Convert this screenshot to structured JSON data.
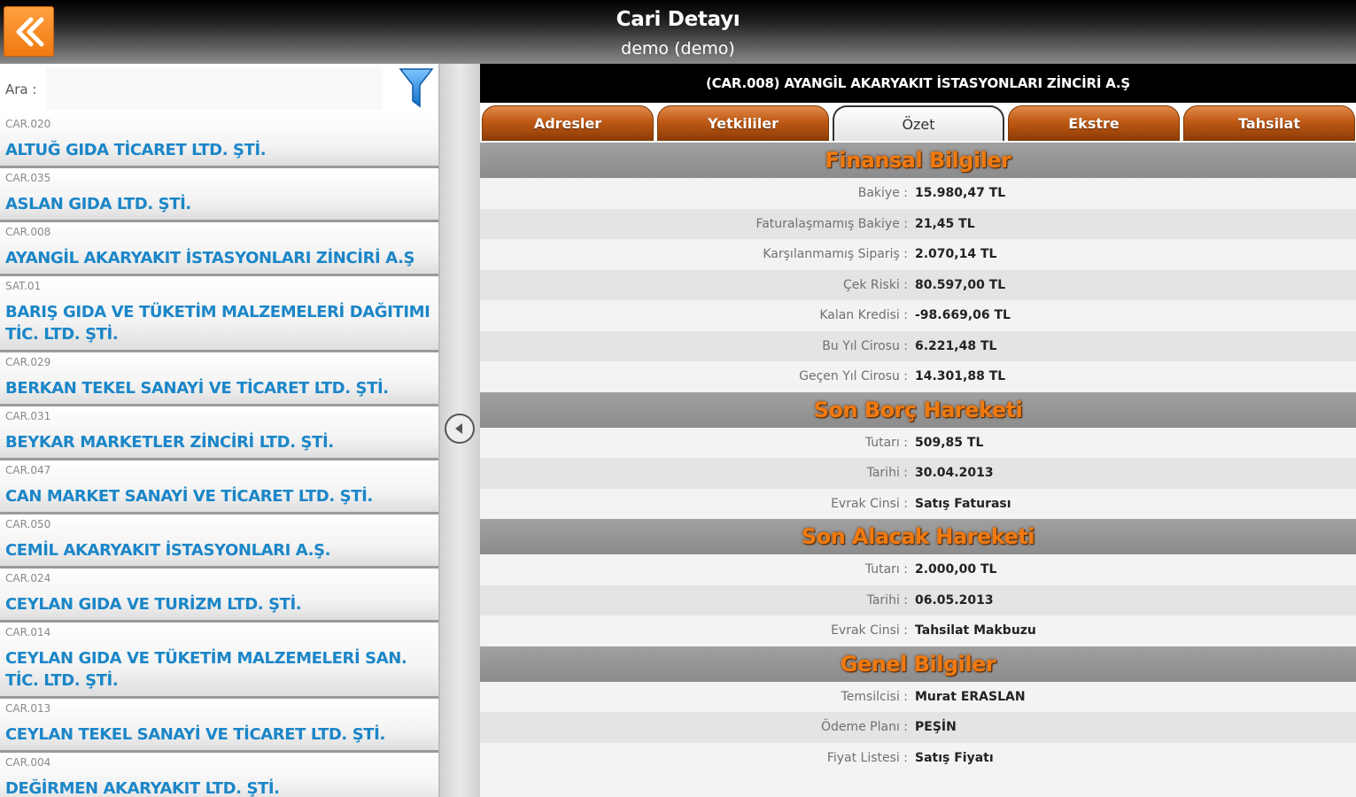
{
  "header": {
    "title": "Cari Detayı",
    "subtitle": "demo (demo)",
    "back_icon": "double-chevron-left-icon"
  },
  "search": {
    "label": "Ara :",
    "value": "",
    "filter_icon": "filter-funnel-icon"
  },
  "accounts": [
    {
      "code": "CAR.020",
      "name": "ALTUĞ GIDA TİCARET LTD. ŞTİ."
    },
    {
      "code": "CAR.035",
      "name": "ASLAN GIDA LTD. ŞTİ."
    },
    {
      "code": "CAR.008",
      "name": "AYANGİL AKARYAKIT İSTASYONLARI ZİNCİRİ A.Ş"
    },
    {
      "code": "SAT.01",
      "name": "BARIŞ GIDA VE TÜKETİM MALZEMELERİ DAĞITIMI TİC. LTD. ŞTİ."
    },
    {
      "code": "CAR.029",
      "name": "BERKAN TEKEL SANAYİ VE TİCARET LTD. ŞTİ."
    },
    {
      "code": "CAR.031",
      "name": "BEYKAR MARKETLER ZİNCİRİ LTD. ŞTİ."
    },
    {
      "code": "CAR.047",
      "name": "CAN MARKET SANAYİ VE TİCARET LTD. ŞTİ."
    },
    {
      "code": "CAR.050",
      "name": "CEMİL AKARYAKIT İSTASYONLARI A.Ş."
    },
    {
      "code": "CAR.024",
      "name": "CEYLAN GIDA VE TURİZM LTD. ŞTİ."
    },
    {
      "code": "CAR.014",
      "name": "CEYLAN GIDA VE TÜKETİM MALZEMELERİ SAN. TİC. LTD. ŞTİ."
    },
    {
      "code": "CAR.013",
      "name": "CEYLAN TEKEL SANAYİ VE TİCARET LTD. ŞTİ."
    },
    {
      "code": "CAR.004",
      "name": "DEĞİRMEN AKARYAKIT LTD. ŞTİ."
    }
  ],
  "detail": {
    "account_title": "(CAR.008) AYANGİL AKARYAKIT İSTASYONLARI ZİNCİRİ A.Ş",
    "tabs": [
      {
        "label": "Adresler",
        "active": false
      },
      {
        "label": "Yetkililer",
        "active": false
      },
      {
        "label": "Özet",
        "active": true
      },
      {
        "label": "Ekstre",
        "active": false
      },
      {
        "label": "Tahsilat",
        "active": false
      }
    ],
    "sections": [
      {
        "title": "Finansal Bilgiler",
        "rows": [
          {
            "label": "Bakiye :",
            "value": "15.980,47 TL"
          },
          {
            "label": "Faturalaşmamış Bakiye :",
            "value": "21,45 TL"
          },
          {
            "label": "Karşılanmamış Sipariş :",
            "value": "2.070,14 TL"
          },
          {
            "label": "Çek Riski :",
            "value": "80.597,00 TL"
          },
          {
            "label": "Kalan Kredisi :",
            "value": "-98.669,06 TL"
          },
          {
            "label": "Bu Yıl Cirosu :",
            "value": "6.221,48 TL"
          },
          {
            "label": "Geçen Yıl Cirosu :",
            "value": "14.301,88 TL"
          }
        ]
      },
      {
        "title": "Son Borç Hareketi",
        "rows": [
          {
            "label": "Tutarı :",
            "value": "509,85 TL"
          },
          {
            "label": "Tarihi :",
            "value": "30.04.2013"
          },
          {
            "label": "Evrak Cinsi :",
            "value": "Satış Faturası"
          }
        ]
      },
      {
        "title": "Son Alacak Hareketi",
        "rows": [
          {
            "label": "Tutarı :",
            "value": "2.000,00 TL"
          },
          {
            "label": "Tarihi :",
            "value": "06.05.2013"
          },
          {
            "label": "Evrak Cinsi :",
            "value": "Tahsilat Makbuzu"
          }
        ]
      },
      {
        "title": "Genel Bilgiler",
        "rows": [
          {
            "label": "Temsilcisi :",
            "value": "Murat ERASLAN"
          },
          {
            "label": "Ödeme Planı :",
            "value": "PEŞİN"
          },
          {
            "label": "Fiyat Listesi :",
            "value": "Satış Fiyatı"
          }
        ]
      }
    ]
  },
  "colors": {
    "accent_orange": "#f07a10",
    "link_blue": "#1b86c8",
    "tab_brown": "#b55210"
  }
}
